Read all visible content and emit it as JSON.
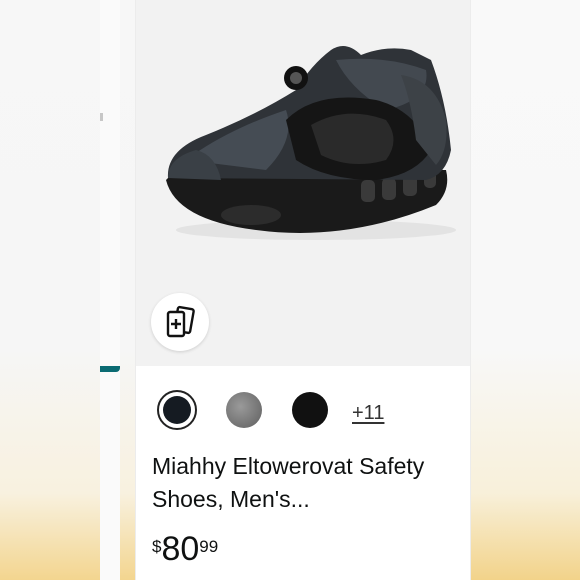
{
  "product": {
    "title": "Miahhy Eltowerovat Safety Shoes, Men's...",
    "price": {
      "symbol": "$",
      "whole": "80",
      "fraction": "99"
    },
    "swatches": [
      {
        "name": "black-navy",
        "color": "#151b22",
        "selected": true
      },
      {
        "name": "grey",
        "color": "#7a7a7a",
        "selected": false
      },
      {
        "name": "black",
        "color": "#111111",
        "selected": false
      }
    ],
    "more_colors_label": "+11",
    "view_in_3d_icon": "ar-cards-icon"
  },
  "colors": {
    "accent_teal": "#0b6b73",
    "image_background": "#f2f2f2"
  }
}
